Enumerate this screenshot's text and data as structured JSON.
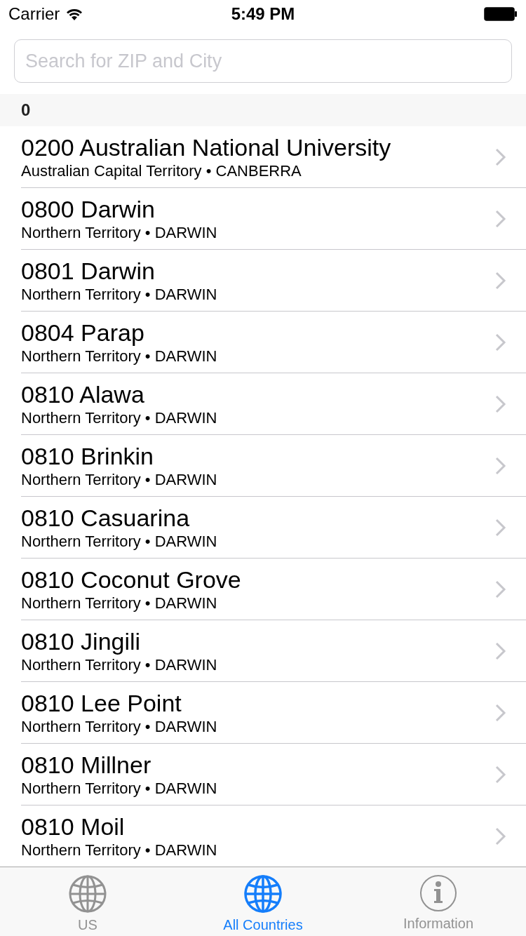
{
  "status_bar": {
    "carrier": "Carrier",
    "time": "5:49 PM"
  },
  "search": {
    "placeholder": "Search for ZIP and City"
  },
  "section": {
    "header": "0",
    "rows": [
      {
        "title": "0200 Australian National University",
        "subtitle": "Australian Capital Territory • CANBERRA"
      },
      {
        "title": "0800 Darwin",
        "subtitle": "Northern Territory • DARWIN"
      },
      {
        "title": "0801 Darwin",
        "subtitle": "Northern Territory • DARWIN"
      },
      {
        "title": "0804 Parap",
        "subtitle": "Northern Territory • DARWIN"
      },
      {
        "title": "0810 Alawa",
        "subtitle": "Northern Territory • DARWIN"
      },
      {
        "title": "0810 Brinkin",
        "subtitle": "Northern Territory • DARWIN"
      },
      {
        "title": "0810 Casuarina",
        "subtitle": "Northern Territory • DARWIN"
      },
      {
        "title": "0810 Coconut Grove",
        "subtitle": "Northern Territory • DARWIN"
      },
      {
        "title": "0810 Jingili",
        "subtitle": "Northern Territory • DARWIN"
      },
      {
        "title": "0810 Lee Point",
        "subtitle": "Northern Territory • DARWIN"
      },
      {
        "title": "0810 Millner",
        "subtitle": "Northern Territory • DARWIN"
      },
      {
        "title": "0810 Moil",
        "subtitle": "Northern Territory • DARWIN"
      }
    ]
  },
  "tab_bar": [
    {
      "label": "US",
      "kind": "globe",
      "selected": false
    },
    {
      "label": "All Countries",
      "kind": "globe",
      "selected": true
    },
    {
      "label": "Information",
      "kind": "info",
      "selected": false
    }
  ]
}
